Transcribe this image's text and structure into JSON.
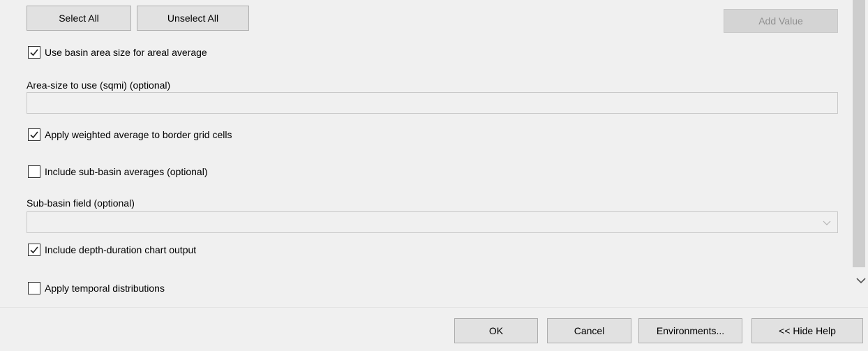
{
  "toolbar": {
    "select_all_label": "Select All",
    "unselect_all_label": "Unselect All",
    "add_value_label": "Add Value"
  },
  "options": {
    "use_basin_area": {
      "label": "Use basin area size for areal average",
      "checked": true
    },
    "apply_weighted_average": {
      "label": "Apply weighted average to border grid cells",
      "checked": true
    },
    "include_sub_basin": {
      "label": "Include sub-basin averages (optional)",
      "checked": false
    },
    "include_depth_duration": {
      "label": "Include depth-duration chart output",
      "checked": true
    },
    "apply_temporal": {
      "label": "Apply temporal distributions",
      "checked": false
    }
  },
  "fields": {
    "area_size": {
      "label": "Area-size to use (sqmi) (optional)",
      "value": ""
    },
    "sub_basin_field": {
      "label": "Sub-basin field (optional)",
      "value": ""
    }
  },
  "footer": {
    "ok_label": "OK",
    "cancel_label": "Cancel",
    "environments_label": "Environments...",
    "hide_help_label": "<< Hide Help"
  },
  "icons": {
    "check": "check-icon",
    "dropdown": "chevron-down-icon",
    "scroll_down": "chevron-down-icon"
  }
}
